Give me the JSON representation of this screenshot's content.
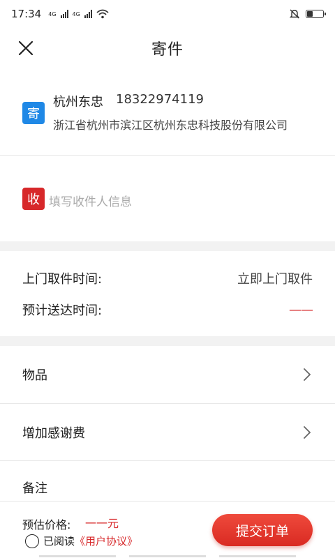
{
  "statusbar": {
    "time": "17:34",
    "net1": "4G",
    "net2": "4G"
  },
  "header": {
    "title": "寄件",
    "close_icon": "close-icon"
  },
  "sender": {
    "tag": "寄",
    "name": "杭州东忠",
    "phone": "18322974119",
    "address": "浙江省杭州市滨江区杭州东忠科技股份有限公司",
    "tag_color": "#1f88e6"
  },
  "receiver": {
    "tag": "收",
    "placeholder": "填写收件人信息",
    "tag_color": "#d7282a"
  },
  "pickup": {
    "time_label": "上门取件时间:",
    "time_value": "立即上门取件",
    "eta_label": "预计送达时间:",
    "eta_value": "——"
  },
  "list": {
    "items_label": "物品",
    "tip_label": "增加感谢费",
    "remark_label": "备注"
  },
  "bottom": {
    "price_label": "预估价格:",
    "price_value": "一一元",
    "read_label": "已阅读",
    "agreement_link": "《用户协议》",
    "submit_label": "提交订单"
  },
  "colors": {
    "accent": "#d7282a",
    "blue": "#1f88e6"
  }
}
